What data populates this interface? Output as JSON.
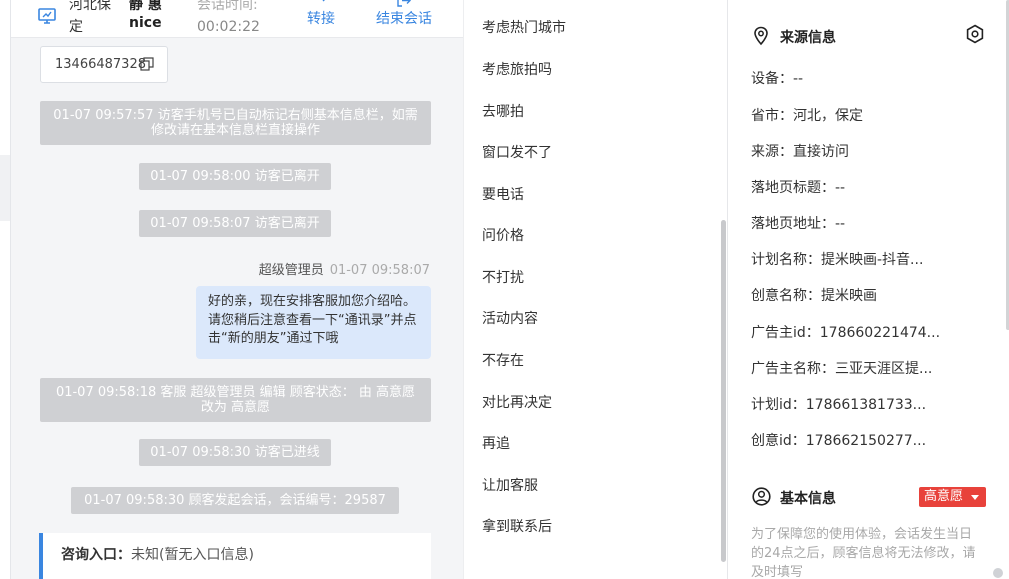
{
  "header": {
    "location": "河北保定",
    "name": "静 惠 nice",
    "session_time_label": "会话时间:",
    "session_time": "00:02:22",
    "transfer_label": "转接",
    "end_label": "结束会话"
  },
  "chat": {
    "phone": "13466487328",
    "system_messages": [
      "01-07 09:57:57 访客手机号已自动标记右侧基本信息栏，如需修改请在基本信息栏直接操作",
      "01-07 09:58:00 访客已离开",
      "01-07 09:58:07 访客已离开",
      "01-07 09:58:18 客服 超级管理员 编辑 顾客状态： 由 高意愿 改为 高意愿",
      "01-07 09:58:30 访客已进线",
      "01-07 09:58:30 顾客发起会话，会话编号：29587"
    ],
    "agent_message": {
      "sender": "超级管理员",
      "time": "01-07 09:58:07",
      "text": "好的亲，现在安排客服加您介绍哈。请您稍后注意查看一下“通讯录”并点击“新的朋友”通过下哦"
    },
    "entry_label": "咨询入口：",
    "entry_value": "未知(暂无入口信息)"
  },
  "phrases": [
    "考虑热门城市",
    "考虑旅拍吗",
    "去哪拍",
    "窗口发不了",
    "要电话",
    "问价格",
    "不打扰",
    "活动内容",
    "不存在",
    "对比再决定",
    "再追",
    "让加客服",
    "拿到联系后"
  ],
  "source_info": {
    "title": "来源信息",
    "rows": [
      "设备：--",
      "省市：河北，保定",
      "来源：直接访问",
      "落地页标题：--",
      "落地页地址：--",
      "计划名称：提米映画-抖音...",
      "创意名称：提米映画",
      "广告主id：178660221474...",
      "广告主名称：三亚天涯区提...",
      "计划id：178661381733...",
      "创意id：178662150277..."
    ]
  },
  "basic_info": {
    "title": "基本信息",
    "status_badge": "高意愿",
    "notice": "为了保障您的使用体验，会话发生当日的24点之后，顾客信息将无法修改，请及时填写"
  },
  "colors": {
    "accent": "#3a86e0",
    "system_bubble": "#cfd0d3",
    "agent_bubble": "#dbe8fb",
    "badge": "#e8423b"
  },
  "icons": {
    "monitor": "monitor-icon",
    "transfer": "transfer-icon",
    "end": "exit-icon",
    "copy": "copy-icon",
    "location": "location-icon",
    "settings": "gear-icon",
    "user": "user-circle-icon"
  }
}
